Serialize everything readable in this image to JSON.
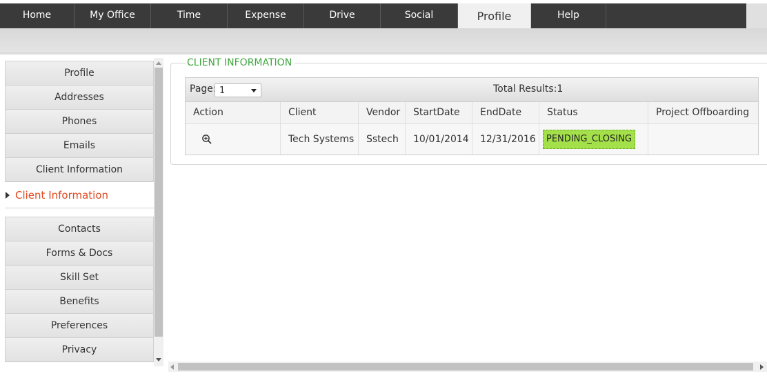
{
  "nav": {
    "tabs": [
      {
        "label": "Home"
      },
      {
        "label": "My Office"
      },
      {
        "label": "Time"
      },
      {
        "label": "Expense"
      },
      {
        "label": "Drive"
      },
      {
        "label": "Social"
      },
      {
        "label": "Profile"
      },
      {
        "label": "Help"
      }
    ],
    "active_tab": "Profile"
  },
  "sidebar": {
    "items_top": [
      {
        "label": "Profile"
      },
      {
        "label": "Addresses"
      },
      {
        "label": "Phones"
      },
      {
        "label": "Emails"
      },
      {
        "label": "Client Information"
      }
    ],
    "active_item": {
      "label": "Client Information"
    },
    "items_bottom": [
      {
        "label": "Contacts"
      },
      {
        "label": "Forms & Docs"
      },
      {
        "label": "Skill Set"
      },
      {
        "label": "Benefits"
      },
      {
        "label": "Preferences"
      },
      {
        "label": "Privacy"
      }
    ]
  },
  "main": {
    "section_title": "CLIENT INFORMATION",
    "pager": {
      "label": "Page:",
      "selected_page": "1",
      "total_results": "Total Results:1"
    },
    "table": {
      "columns": [
        "Action",
        "Client",
        "Vendor",
        "StartDate",
        "EndDate",
        "Status",
        "Project Offboarding"
      ],
      "rows": [
        {
          "action_icon": "zoom-in-icon",
          "client": "Tech Systems",
          "vendor": "Sstech",
          "start_date": "10/01/2014",
          "end_date": "12/31/2016",
          "status": "PENDING_CLOSING",
          "project_offboarding": ""
        }
      ]
    }
  },
  "colors": {
    "nav_bg": "#3a3a3a",
    "accent_green": "#3da63d",
    "active_sidebar": "#e0481e",
    "status_bg": "#a4e04a"
  }
}
